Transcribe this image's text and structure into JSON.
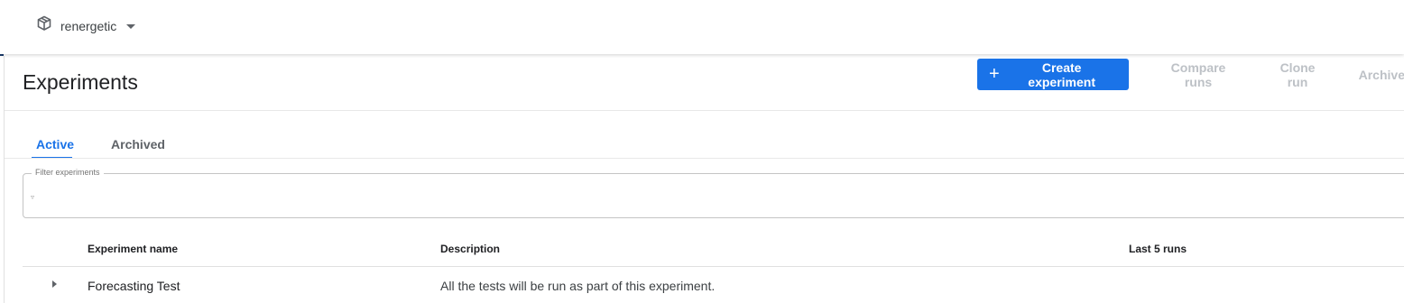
{
  "header": {
    "namespace": "renergetic",
    "namespace_icon": "cube-icon"
  },
  "page": {
    "title": "Experiments"
  },
  "toolbar": {
    "create_label": "Create experiment",
    "compare_label": "Compare runs",
    "clone_label": "Clone run",
    "archive_label": "Archive",
    "primary_color": "#1a73e8",
    "disabled_color": "#bdc1c6"
  },
  "tabs": [
    {
      "label": "Active",
      "active": true
    },
    {
      "label": "Archived",
      "active": false
    }
  ],
  "filter": {
    "label": "Filter experiments",
    "icon": "filter-icon"
  },
  "table": {
    "columns": [
      "Experiment name",
      "Description",
      "Last 5 runs"
    ],
    "rows": [
      {
        "name": "Forecasting Test",
        "description": "All the tests will be run as part of this experiment."
      }
    ]
  }
}
